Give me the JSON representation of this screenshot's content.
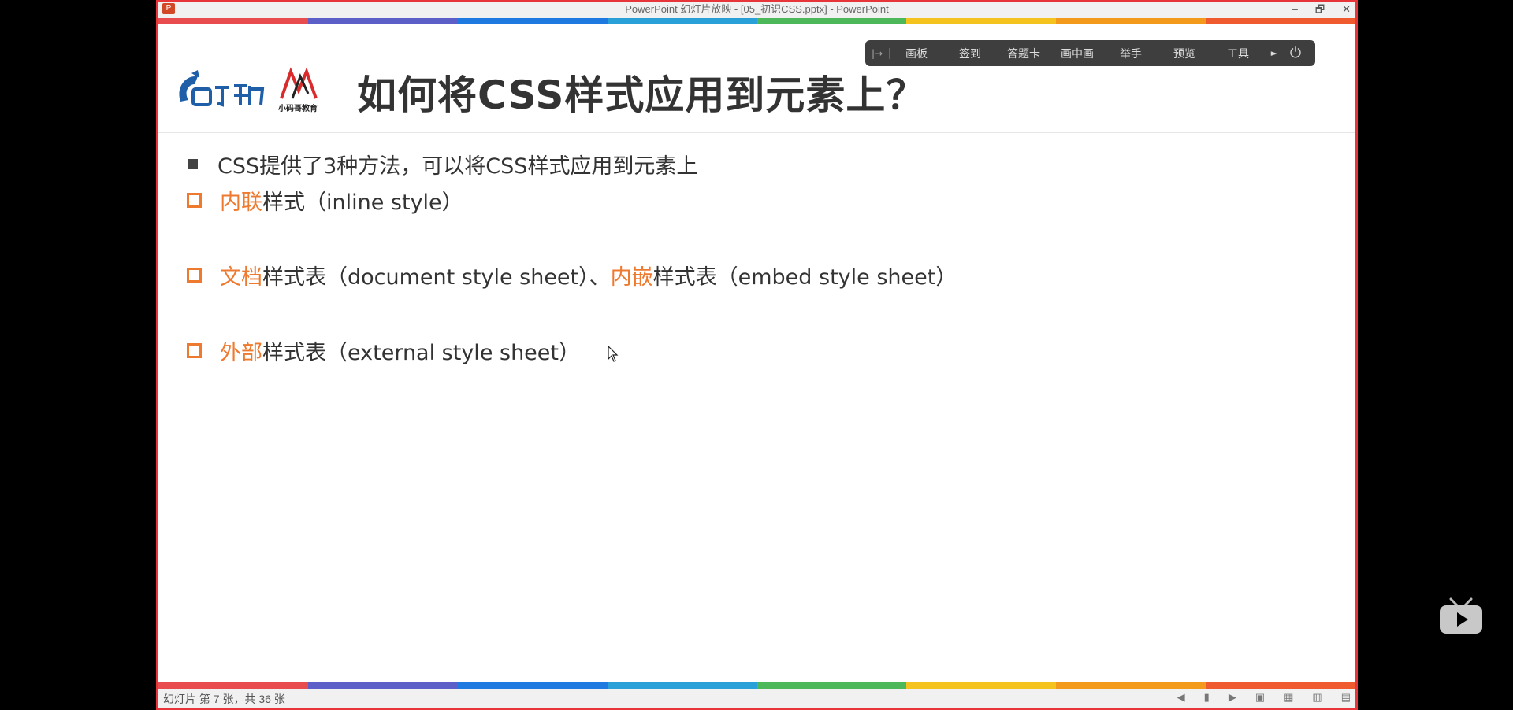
{
  "window": {
    "title": "PowerPoint 幻灯片放映 - [05_初识CSS.pptx] - PowerPoint",
    "app_icon": "P",
    "controls": [
      "–",
      "🗗",
      "✕"
    ]
  },
  "stripe_colors": [
    "#e84c4f",
    "#5b5fc7",
    "#1e7ae0",
    "#2aa0d8",
    "#4cb85a",
    "#f5c31d",
    "#f39a1c",
    "#ef5a2f"
  ],
  "toolbar": {
    "handle": "|→",
    "items": [
      "画板",
      "签到",
      "答题卡",
      "画中画",
      "举手",
      "预览",
      "工具"
    ],
    "arrow": "►",
    "power": "⏻"
  },
  "slide": {
    "title": "如何将CSS样式应用到元素上？",
    "logo2_caption": "小码哥教育",
    "bullets": [
      {
        "marker": "square",
        "parts": [
          {
            "text": "CSS提供了3种方法，可以将CSS样式应用到元素上",
            "hl": false
          }
        ]
      },
      {
        "marker": "hollow",
        "parts": [
          {
            "text": "内联",
            "hl": true
          },
          {
            "text": "样式（inline style）",
            "hl": false
          }
        ]
      },
      {
        "marker": "hollow",
        "parts": [
          {
            "text": "文档",
            "hl": true
          },
          {
            "text": "样式表（document style sheet）、",
            "hl": false
          },
          {
            "text": "内嵌",
            "hl": true
          },
          {
            "text": "样式表（embed  style sheet）",
            "hl": false
          }
        ]
      },
      {
        "marker": "hollow",
        "parts": [
          {
            "text": "外部",
            "hl": true
          },
          {
            "text": "样式表（external style sheet）",
            "hl": false
          }
        ]
      }
    ]
  },
  "status": {
    "slide_info": "幻灯片 第 7 张，共 36 张"
  }
}
